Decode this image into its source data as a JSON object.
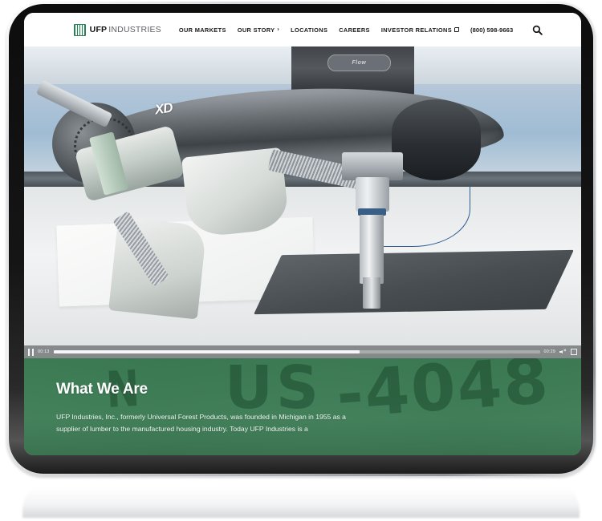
{
  "device": {
    "type": "tablet-mockup"
  },
  "header": {
    "logo": {
      "icon": "ufp-lumber-logo-icon",
      "bold": "UFP",
      "light": "INDUSTRIES"
    },
    "nav": [
      {
        "label": "OUR MARKETS",
        "has_chevron": false,
        "has_external": false
      },
      {
        "label": "OUR STORY",
        "has_chevron": true,
        "chevron": "›",
        "has_external": false
      },
      {
        "label": "LOCATIONS",
        "has_chevron": false,
        "has_external": false
      },
      {
        "label": "CAREERS",
        "has_chevron": false,
        "has_external": false
      },
      {
        "label": "INVESTOR RELATIONS",
        "has_chevron": false,
        "has_external": true
      }
    ],
    "phone": "(800) 598-9663",
    "search_icon": "search-icon"
  },
  "video": {
    "scene_description": "Industrial waterjet cutting machine head",
    "machine_brand_badge": "Flow",
    "arm_marking": "XD",
    "controls": {
      "play_state_icon": "pause-icon",
      "current_time": "00:13",
      "duration": "00:29",
      "progress_percent": 63,
      "volume_icon": "volume-muted-icon",
      "fullscreen_icon": "fullscreen-icon"
    }
  },
  "green_section": {
    "headline": "What We Are",
    "body": "UFP Industries, Inc., formerly Universal Forest Products, was founded in Michigan in 1955 as a supplier of lumber to the manufactured housing industry. Today UFP Industries is a",
    "background_marks": [
      "N",
      "US",
      "-4048"
    ]
  },
  "colors": {
    "brand_green": "#2e7d5b",
    "section_green": "#3f7a54",
    "header_bg": "#ffffff",
    "nav_text": "#1a1a1a",
    "bezel": "#121212"
  }
}
